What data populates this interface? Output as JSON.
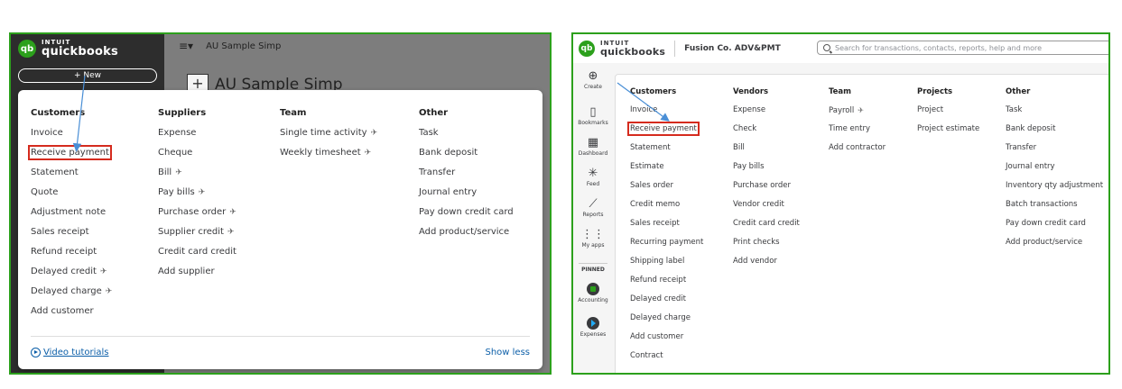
{
  "left": {
    "logo": {
      "brand": "INTUIT",
      "product": "quickbooks",
      "badge": "qb"
    },
    "new_button": "+ New",
    "company": "AU Sample Simp",
    "title": "AU Sample Simp",
    "plus": "+",
    "columns": [
      {
        "header": "Customers",
        "items": [
          "Invoice",
          "Receive payment",
          "Statement",
          "Quote",
          "Adjustment note",
          "Sales receipt",
          "Refund receipt",
          "Delayed credit",
          "Delayed charge",
          "Add customer"
        ],
        "starred": [
          7,
          8
        ],
        "highlight": 1
      },
      {
        "header": "Suppliers",
        "items": [
          "Expense",
          "Cheque",
          "Bill",
          "Pay bills",
          "Purchase order",
          "Supplier credit",
          "Credit card credit",
          "Add supplier"
        ],
        "starred": [
          2,
          3,
          4,
          5
        ],
        "highlight": -1
      },
      {
        "header": "Team",
        "items": [
          "Single time activity",
          "Weekly timesheet"
        ],
        "starred": [
          0,
          1
        ],
        "highlight": -1
      },
      {
        "header": "Other",
        "items": [
          "Task",
          "Bank deposit",
          "Transfer",
          "Journal entry",
          "Pay down credit card",
          "Add product/service"
        ],
        "starred": [],
        "highlight": -1
      }
    ],
    "video_tutorials": "Video tutorials",
    "show_less": "Show less"
  },
  "right": {
    "logo": {
      "brand": "INTUIT",
      "product": "quickbooks",
      "badge": "qb"
    },
    "company": "Fusion Co. ADV&PMT",
    "search_placeholder": "Search for transactions, contacts, reports, help and more",
    "nav": [
      {
        "label": "Create",
        "icon": "plus-circle-icon"
      },
      {
        "label": "Bookmarks",
        "icon": "bookmark-icon"
      },
      {
        "label": "Dashboard",
        "icon": "dashboard-icon"
      },
      {
        "label": "Feed",
        "icon": "sparkle-icon"
      },
      {
        "label": "Reports",
        "icon": "chart-icon"
      },
      {
        "label": "My apps",
        "icon": "grid-icon"
      },
      {
        "label": "PINNED",
        "icon": ""
      },
      {
        "label": "Accounting",
        "icon": "accounting-icon"
      },
      {
        "label": "Expenses",
        "icon": "expenses-icon"
      }
    ],
    "columns": [
      {
        "header": "Customers",
        "items": [
          "Invoice",
          "Receive payment",
          "Statement",
          "Estimate",
          "Sales order",
          "Credit memo",
          "Sales receipt",
          "Recurring payment",
          "Shipping label",
          "Refund receipt",
          "Delayed credit",
          "Delayed charge",
          "Add customer",
          "Contract"
        ],
        "starred": [],
        "highlight": 1
      },
      {
        "header": "Vendors",
        "items": [
          "Expense",
          "Check",
          "Bill",
          "Pay bills",
          "Purchase order",
          "Vendor credit",
          "Credit card credit",
          "Print checks",
          "Add vendor"
        ],
        "starred": [],
        "highlight": -1
      },
      {
        "header": "Team",
        "items": [
          "Payroll",
          "Time entry",
          "Add contractor"
        ],
        "starred": [
          0
        ],
        "highlight": -1
      },
      {
        "header": "Projects",
        "items": [
          "Project",
          "Project estimate"
        ],
        "starred": [],
        "highlight": -1
      },
      {
        "header": "Other",
        "items": [
          "Task",
          "Bank deposit",
          "Transfer",
          "Journal entry",
          "Inventory qty adjustment",
          "Batch transactions",
          "Pay down credit card",
          "Add product/service"
        ],
        "starred": [],
        "highlight": -1
      }
    ]
  },
  "colors": {
    "accent": "#2ca01c",
    "highlight": "#d52b1e",
    "arrow": "#4a8fd6",
    "link": "#0b5ea8"
  }
}
